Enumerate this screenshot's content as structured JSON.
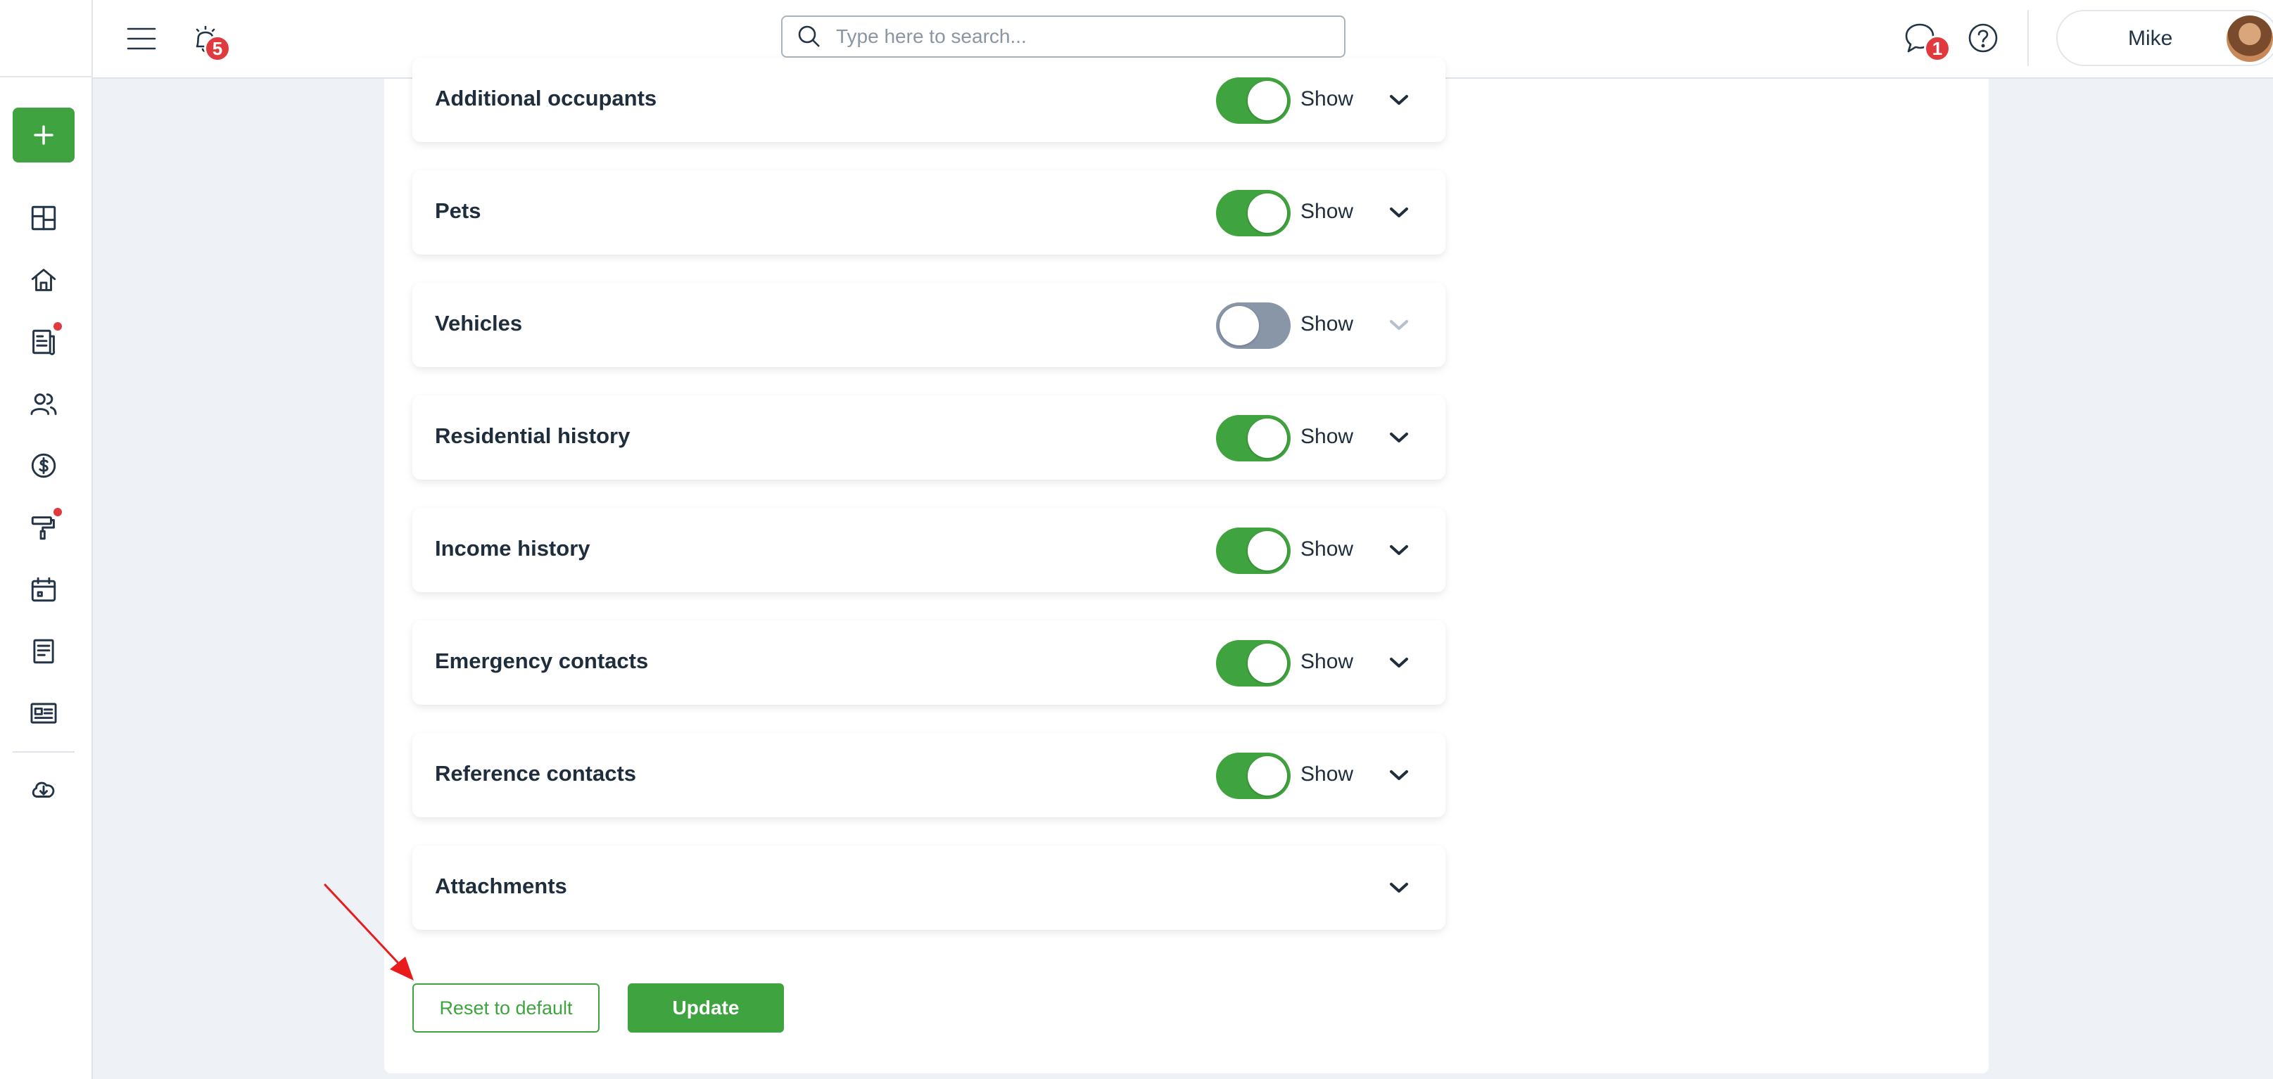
{
  "topbar": {
    "notifications_count": "5",
    "search_placeholder": "Type here to search...",
    "messages_count": "1",
    "user_name": "Mike"
  },
  "sections": [
    {
      "title": "Additional occupants",
      "toggle_label": "Show",
      "enabled": true
    },
    {
      "title": "Pets",
      "toggle_label": "Show",
      "enabled": true
    },
    {
      "title": "Vehicles",
      "toggle_label": "Show",
      "enabled": false
    },
    {
      "title": "Residential history",
      "toggle_label": "Show",
      "enabled": true
    },
    {
      "title": "Income history",
      "toggle_label": "Show",
      "enabled": true
    },
    {
      "title": "Emergency contacts",
      "toggle_label": "Show",
      "enabled": true
    },
    {
      "title": "Reference contacts",
      "toggle_label": "Show",
      "enabled": true
    },
    {
      "title": "Attachments"
    }
  ],
  "actions": {
    "reset_label": "Reset to default",
    "update_label": "Update"
  },
  "colors": {
    "accent_green": "#3fa33f",
    "toggle_off": "#8896a8",
    "badge_red": "#e0393e",
    "annotation_arrow": "#e81c1c"
  }
}
